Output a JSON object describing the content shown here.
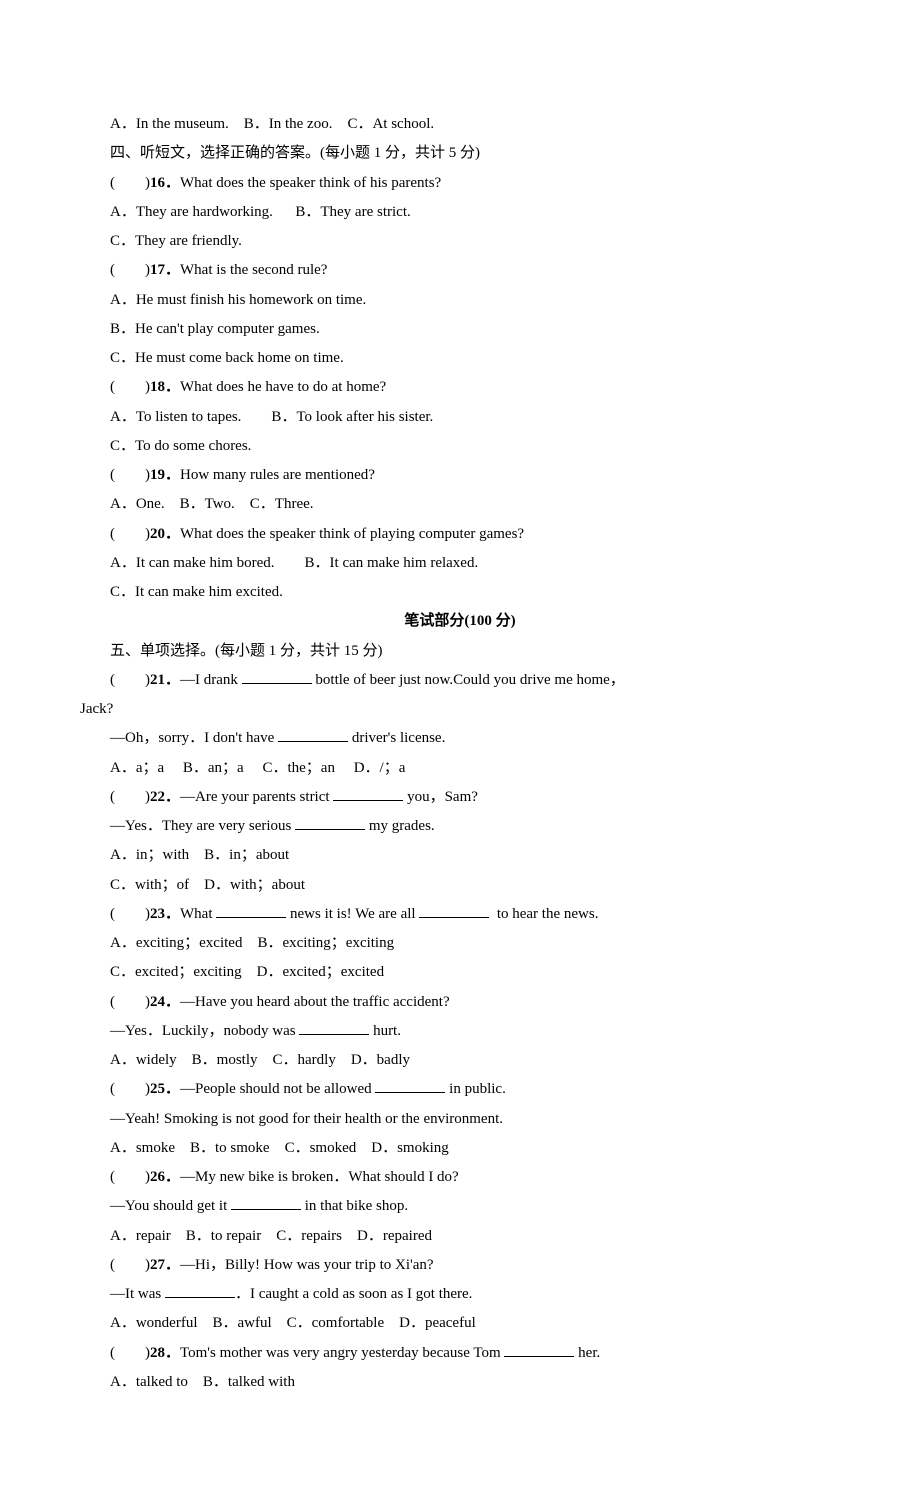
{
  "s3": {
    "q_a": "A．In the museum.　B．In the zoo.　C．At school."
  },
  "s4": {
    "header": "四、听短文，选择正确的答案。(每小题 1 分，共计 5 分)",
    "q16": {
      "num": "16．",
      "prompt": "(　　)",
      "stem": "What does the speaker think of his parents?",
      "a": "A．They are hard­working.      B．They are strict.",
      "c": "C．They are friendly."
    },
    "q17": {
      "num": "17．",
      "prompt": "(　　)",
      "stem": "What is the second rule?",
      "a": "A．He must finish his homework on time.",
      "b": "B．He can't play computer games.",
      "c": "C．He must come back home on time."
    },
    "q18": {
      "num": "18．",
      "prompt": "(　　)",
      "stem": "What does he have to do at home?",
      "a": "A．To listen to tapes.        B．To look after his sister.",
      "c": "C．To do some chores."
    },
    "q19": {
      "num": "19．",
      "prompt": "(　　)",
      "stem": "How many rules are mentioned?",
      "a": "A．One.　B．Two.　C．Three."
    },
    "q20": {
      "num": "20．",
      "prompt": "(　　)",
      "stem": "What does the speaker think of playing computer games?",
      "a": "A．It can make him bored.        B．It can make him relaxed.",
      "c": "C．It can make him excited."
    }
  },
  "written_header": "笔试部分(100 分)",
  "s5": {
    "header": "五、单项选择。(每小题 1 分，共计 15 分)",
    "q21": {
      "prompt": "(　　)",
      "num": "21．",
      "stem_pre": "—I drank ",
      "stem_post": " bottle of beer just now.Could you drive me home，",
      "line2": "Jack?",
      "reply_pre": "—Oh，sorry．I don't have ",
      "reply_post": " driver's license.",
      "opts": "A．a；a     B．an；a     C．the；an     D．/；a"
    },
    "q22": {
      "prompt": "(　　)",
      "num": "22．",
      "stem_pre": "—Are your parents strict ",
      "stem_post": " you，Sam?",
      "reply_pre": "—Yes．They are very serious ",
      "reply_post": " my grades.",
      "opts1": "A．in；with　B．in；about",
      "opts2": "C．with；of　D．with；about"
    },
    "q23": {
      "prompt": "(　　)",
      "num": "23．",
      "stem_pre": "What ",
      "stem_mid": " news it is! We are all ",
      "stem_post": "  to hear the news.",
      "opts1": "A．exciting；excited　B．exciting；exciting",
      "opts2": "C．excited；exciting　D．excited；excited"
    },
    "q24": {
      "prompt": "(　　)",
      "num": "24．",
      "stem": "—Have you heard about the traffic accident?",
      "reply_pre": "—Yes．Luckily，nobody was ",
      "reply_post": " hurt.",
      "opts": "A．widely　B．mostly　C．hardly　D．badly"
    },
    "q25": {
      "prompt": "(　　)",
      "num": "25．",
      "stem_pre": "—People should not be allowed ",
      "stem_post": " in public.",
      "reply": "—Yeah! Smoking is not good for their health or the environment.",
      "opts": "A．smoke　B．to smoke　C．smoked　D．smoking"
    },
    "q26": {
      "prompt": "(　　)",
      "num": "26．",
      "stem": "—My new bike is broken．What should I do?",
      "reply_pre": "—You should get it ",
      "reply_post": " in that bike shop.",
      "opts": "A．repair　B．to repair　C．repairs　D．repaired"
    },
    "q27": {
      "prompt": "(　　)",
      "num": "27．",
      "stem": "—Hi，Billy! How was your trip to Xi'an?",
      "reply_pre": "—It was ",
      "reply_post": "．I caught a cold as soon as I got there.",
      "opts": "A．wonderful　B．awful　C．comfortable　D．peaceful"
    },
    "q28": {
      "prompt": "(　　)",
      "num": "28．",
      "stem_pre": "Tom's mother was very angry yesterday because Tom ",
      "stem_post": " her.",
      "opts": "A．talked to　B．talked with"
    }
  }
}
